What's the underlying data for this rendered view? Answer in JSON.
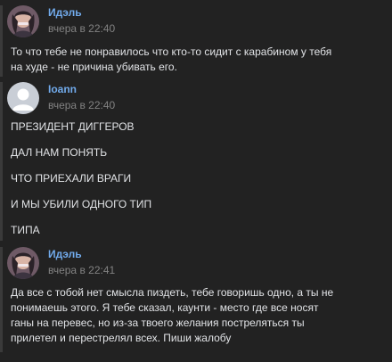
{
  "messages": [
    {
      "author": "Идэль",
      "time": "вчера в 22:40",
      "avatar_color": "#9a7e8c",
      "lines": [
        "То что тебе не понравилось что кто-то сидит с карабином у тебя",
        "на худе - не причина убивать его."
      ]
    },
    {
      "author": "Ioann",
      "time": "вчера в 22:40",
      "avatar_color": "#c9ced6",
      "lines": [
        "ПРЕЗИДЕНТ ДИГГЕРОВ",
        "ДАЛ НАМ ПОНЯТЬ",
        "ЧТО ПРИЕХАЛИ ВРАГИ",
        "И МЫ УБИЛИ ОДНОГО ТИП",
        "ТИПА"
      ]
    },
    {
      "author": "Идэль",
      "time": "вчера в 22:41",
      "avatar_color": "#9a7e8c",
      "lines": [
        "Да все с тобой нет смысла пиздеть, тебе говоришь одно, а ты не",
        "понимаешь этого. Я тебе сказал, каунти - место где все носят",
        "ганы на перевес, но из-за твоего желания постреляться ты",
        "прилетел и перестрелял всех. Пиши жалобу"
      ]
    }
  ],
  "colors": {
    "background": "#222222",
    "author": "#71aaeb",
    "time": "#828282",
    "text": "#e1e3e6"
  }
}
